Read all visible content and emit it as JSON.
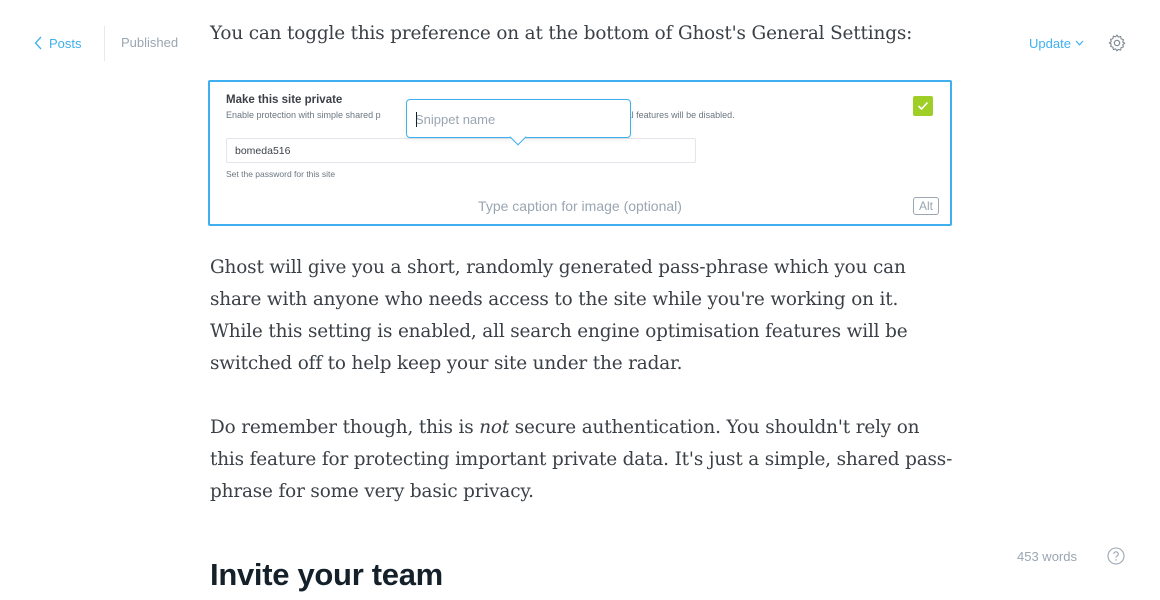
{
  "nav": {
    "back_label": "Posts",
    "status": "Published"
  },
  "toolbar": {
    "update_label": "Update",
    "settings_icon": "gear-icon",
    "accent": "#3eb0ef"
  },
  "article": {
    "intro": "You can toggle this preference on at the bottom of Ghost's General Settings:",
    "paragraph1": "Ghost will give you a short, randomly generated pass-phrase which you can share with anyone who needs access to the site while you're working on it. While this setting is enabled, all search engine optimisation features will be switched off to help keep your site under the radar.",
    "paragraph2_before": "Do remember though, this is ",
    "paragraph2_emphasis": "not",
    "paragraph2_after": " secure authentication. You shouldn't rely on this feature for protecting important private data. It's just a simple, shared pass-phrase for some very basic privacy.",
    "heading": "Invite your team"
  },
  "image_card": {
    "screenshot": {
      "title": "Make this site private",
      "description": "Enable protection with simple shared p",
      "description_tail": "al features will be disabled.",
      "password_value": "bomeda516",
      "password_help": "Set the password for this site",
      "checkbox_checked": true,
      "checkbox_color": "#9fce27"
    },
    "caption_placeholder": "Type caption for image (optional)",
    "alt_label": "Alt"
  },
  "snippet_popup": {
    "placeholder": "Snippet name",
    "value": ""
  },
  "footer": {
    "word_count": "453 words",
    "help_icon": "question-circle-icon"
  }
}
